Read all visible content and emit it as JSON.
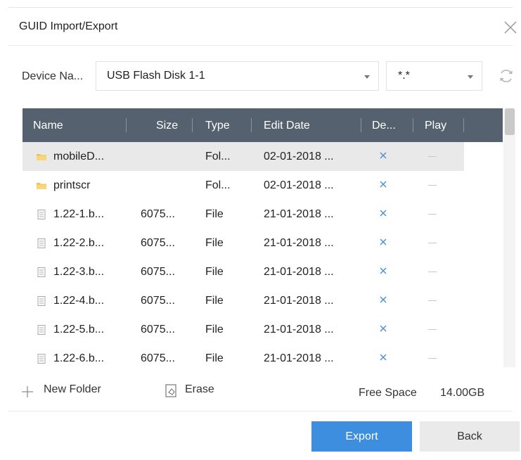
{
  "dialog": {
    "title": "GUID Import/Export"
  },
  "device": {
    "label": "Device Na...",
    "selected": "USB Flash Disk 1-1",
    "filter": "*.*"
  },
  "table": {
    "columns": [
      "Name",
      "Size",
      "Type",
      "Edit Date",
      "De...",
      "Play"
    ],
    "rows": [
      {
        "name": "mobileD...",
        "size": "",
        "type": "Fol...",
        "date": "02-01-2018 ...",
        "icon": "folder-icon"
      },
      {
        "name": "printscr",
        "size": "",
        "type": "Fol...",
        "date": "02-01-2018 ...",
        "icon": "folder-icon"
      },
      {
        "name": "1.22-1.b...",
        "size": "6075...",
        "type": "File",
        "date": "21-01-2018 ...",
        "icon": "file-icon"
      },
      {
        "name": "1.22-2.b...",
        "size": "6075...",
        "type": "File",
        "date": "21-01-2018 ...",
        "icon": "file-icon"
      },
      {
        "name": "1.22-3.b...",
        "size": "6075...",
        "type": "File",
        "date": "21-01-2018 ...",
        "icon": "file-icon"
      },
      {
        "name": "1.22-4.b...",
        "size": "6075...",
        "type": "File",
        "date": "21-01-2018 ...",
        "icon": "file-icon"
      },
      {
        "name": "1.22-5.b...",
        "size": "6075...",
        "type": "File",
        "date": "21-01-2018 ...",
        "icon": "file-icon"
      },
      {
        "name": "1.22-6.b...",
        "size": "6075...",
        "type": "File",
        "date": "21-01-2018 ...",
        "icon": "file-icon"
      }
    ]
  },
  "actions": {
    "new_folder": "New Folder",
    "erase": "Erase"
  },
  "free_space": {
    "label": "Free Space",
    "value": "14.00GB"
  },
  "buttons": {
    "export": "Export",
    "back": "Back"
  },
  "colors": {
    "header_bg": "#55616e",
    "accent": "#3e8ee0",
    "delete_icon": "#4a90d9",
    "folder_icon": "#f0c34a"
  }
}
